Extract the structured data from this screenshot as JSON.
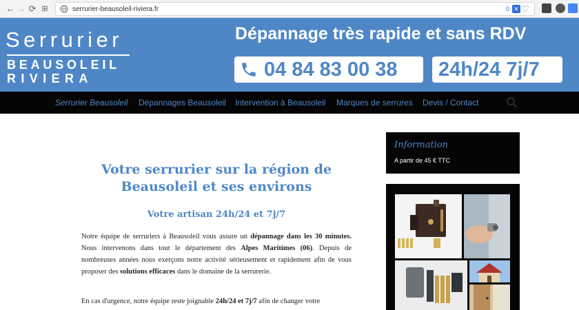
{
  "browser": {
    "url": "serrurier-beausoleil-riviera.fr",
    "ext_count": "0"
  },
  "header": {
    "logo_title": "Serrurier",
    "logo_line1": "BEAUSOLEIL",
    "logo_line2": "RIVIERA",
    "tagline": "Dépannage très rapide et sans RDV",
    "phone": "04 84 83 00 38",
    "hours": "24h/24 7j/7"
  },
  "nav": {
    "items": [
      {
        "label": "Serrurier Beausoleil"
      },
      {
        "label": "Dépannages Beausoleil"
      },
      {
        "label": "Intervention à Beausoleil"
      },
      {
        "label": "Marques de serrures"
      },
      {
        "label": "Devis / Contact"
      }
    ]
  },
  "main": {
    "headline_l1": "Votre serrurier sur la région de",
    "headline_l2": "Beausoleil et ses environs",
    "subhead": "Votre artisan 24h/24 et 7j/7",
    "p1": {
      "a": "Notre équipe de serruriers à Beausoleil vous assure un ",
      "b": "dépannage dans les 30 minutes.",
      "c": " Nous intervenons dans tout le département des ",
      "d": "Alpes Maritimes (06)",
      "e": ". Depuis de nombreuses années nous exerçons notre activité sérieusement et rapidement afin de vous proposer des ",
      "f": "solutions efficaces",
      "g": " dans le domaine de la serrurerie."
    },
    "p2": {
      "a": "En cas d'urgence, notre équipe reste joignable ",
      "b": "24h/24 et 7j/7",
      "c": " afin de changer votre"
    }
  },
  "sidebar": {
    "info_title": "Information",
    "info_text": "A partir de 45 € TTC"
  },
  "colors": {
    "brand_blue": "#4f87c6",
    "nav_bg": "#050505"
  }
}
